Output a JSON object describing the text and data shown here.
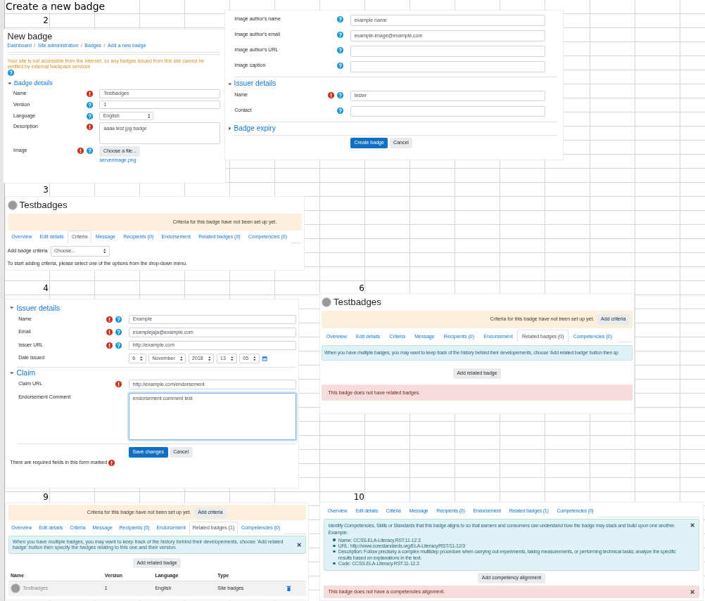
{
  "sheet": {
    "title": "Create a new badge",
    "step_numbers": [
      "2",
      "3",
      "4",
      "6",
      "9",
      "10"
    ]
  },
  "new_badge": {
    "heading": "New badge",
    "breadcrumb_separator": "/",
    "breadcrumbs": [
      "Dashboard",
      "Site administration",
      "Badges",
      "Add a new badge"
    ],
    "warning": "Your site is not accessible from the Internet, so any badges issued from this site cannot be verified by external backpack services",
    "section": {
      "title": "Badge details",
      "expanded": true
    },
    "fields": [
      {
        "label": "Name",
        "required": true,
        "help": false,
        "kind": "text",
        "value": "Testbadges"
      },
      {
        "label": "Version",
        "required": false,
        "help": true,
        "kind": "text",
        "value": "1"
      },
      {
        "label": "Language",
        "required": false,
        "help": true,
        "kind": "select",
        "value": "English"
      },
      {
        "label": "Description",
        "required": true,
        "help": false,
        "kind": "textarea",
        "value": "aaaa test jpg badge",
        "focused": false
      },
      {
        "label": "Image",
        "required": true,
        "help": true,
        "kind": "file",
        "value": "Choose a file...",
        "file_name": "serverimage.png"
      }
    ]
  },
  "new_badge_continued": {
    "fields": [
      {
        "label": "Image author's name",
        "required": false,
        "help": true,
        "kind": "text",
        "value": "example name"
      },
      {
        "label": "Image author's email",
        "required": false,
        "help": true,
        "kind": "text",
        "value": "example-image@example.com"
      },
      {
        "label": "Image author's URL",
        "required": false,
        "help": true,
        "kind": "text"
      },
      {
        "label": "Image caption",
        "required": false,
        "help": true,
        "kind": "text"
      }
    ],
    "sections": [
      {
        "title": "Issuer details",
        "expanded": true,
        "fields": [
          {
            "label": "Name",
            "required": true,
            "help": true,
            "kind": "text",
            "value": "tester"
          },
          {
            "label": "Contact",
            "required": false,
            "help": true,
            "kind": "text"
          }
        ]
      },
      {
        "title": "Badge expiry",
        "expanded": false
      }
    ],
    "buttons": [
      {
        "label": "Create badge",
        "primary": true
      },
      {
        "label": "Cancel",
        "primary": false
      }
    ]
  },
  "criteria_page": {
    "badge_name": "Testbadges",
    "notice": "Criteria for this badge have not been set up yet.",
    "tabs": [
      {
        "label": "Overview",
        "selected": false
      },
      {
        "label": "Edit details",
        "selected": false
      },
      {
        "label": "Criteria",
        "selected": true
      },
      {
        "label": "Message",
        "selected": false
      },
      {
        "label": "Recipients (0)",
        "selected": false
      },
      {
        "label": "Endorsement",
        "selected": false
      },
      {
        "label": "Related badges (0)",
        "selected": false
      },
      {
        "label": "Competencies (0)",
        "selected": false
      }
    ],
    "criteria_label": "Add badge criteria",
    "criteria_select": "Choose...",
    "hint": "To start adding criteria, please select one of the options from the drop-down menu."
  },
  "endorsement_form": {
    "sections": [
      {
        "title": "Issuer details",
        "expanded": true,
        "fields": [
          {
            "label": "Name",
            "required": true,
            "help": true,
            "kind": "text",
            "value": "Example"
          },
          {
            "label": "Email",
            "required": true,
            "help": true,
            "kind": "text",
            "value": "examplejaja@example.com"
          },
          {
            "label": "Issuer URL",
            "required": true,
            "help": true,
            "kind": "text",
            "value": "http://example.com"
          },
          {
            "label": "Date issued",
            "required": false,
            "help": false,
            "kind": "date",
            "parts": [
              "6",
              "November",
              "2018",
              "13",
              "05"
            ]
          }
        ]
      },
      {
        "title": "Claim",
        "expanded": true,
        "fields": [
          {
            "label": "Claim URL",
            "required": true,
            "help": false,
            "kind": "text",
            "value": "http://example.com/endorsement"
          },
          {
            "label": "Endorsement Comment",
            "required": false,
            "help": false,
            "kind": "textarea",
            "value": "endorsement comment test",
            "focused": true
          }
        ]
      }
    ],
    "buttons": [
      {
        "label": "Save changes",
        "primary": true
      },
      {
        "label": "Cancel",
        "primary": false
      }
    ],
    "footnote": "There are required fields in this form marked"
  },
  "related_badges_empty": {
    "badge_name": "Testbadges",
    "notice": "Criteria for this badge have not been set up yet.",
    "notice_button": "Add criteria",
    "tabs": [
      {
        "label": "Overview",
        "selected": false
      },
      {
        "label": "Edit details",
        "selected": false
      },
      {
        "label": "Criteria",
        "selected": false
      },
      {
        "label": "Message",
        "selected": false
      },
      {
        "label": "Recipients (0)",
        "selected": false
      },
      {
        "label": "Endorsement",
        "selected": false
      },
      {
        "label": "Related badges (0)",
        "selected": true
      },
      {
        "label": "Competencies (0)",
        "selected": false
      }
    ],
    "info": "When you have multiple badges, you may want to keep track of the history behind their developements, choose 'Add related badge' button then sp",
    "add_button": "Add related badge",
    "empty_message": "This badge does not have related badges."
  },
  "related_badges_list": {
    "notice": "Criteria for this badge have not been set up yet.",
    "notice_button": "Add criteria",
    "tabs": [
      {
        "label": "Overview",
        "selected": false
      },
      {
        "label": "Edit details",
        "selected": false
      },
      {
        "label": "Criteria",
        "selected": false
      },
      {
        "label": "Message",
        "selected": false
      },
      {
        "label": "Recipients (0)",
        "selected": false
      },
      {
        "label": "Endorsement",
        "selected": false
      },
      {
        "label": "Related badges (1)",
        "selected": true
      },
      {
        "label": "Competencies (0)",
        "selected": false
      }
    ],
    "info": "When you have multiple badges, you may want to keep track of the history behind their developements, choose 'Add related badge' button then specify the badges relating to this one and their version.",
    "info_dismissible": true,
    "add_button": "Add related badge",
    "table": {
      "columns": [
        "Name",
        "Version",
        "Language",
        "Type"
      ],
      "rows": [
        {
          "name": "Testbadges",
          "version": "1",
          "language": "English",
          "type": "Site badges"
        }
      ]
    }
  },
  "competencies": {
    "tabs": [
      {
        "label": "Overview",
        "selected": false
      },
      {
        "label": "Edit details",
        "selected": false
      },
      {
        "label": "Criteria",
        "selected": false
      },
      {
        "label": "Message",
        "selected": false
      },
      {
        "label": "Recipients (0)",
        "selected": false
      },
      {
        "label": "Endorsement",
        "selected": false
      },
      {
        "label": "Related badges (1)",
        "selected": false
      },
      {
        "label": "Competencies (0)",
        "selected": false
      }
    ],
    "info": {
      "intro": "Identify Competencies, Skills or Standards that this badge aligns to so that earners and consumers can understand how the badge may stack and build upon one another.",
      "example_label": "Example:",
      "dismissible": true,
      "items": [
        "Name: CCSS.ELA-Literacy.RST.11-12.3",
        "URL: http://www.corestandards.org/ELA-Literacy/RST/11-12/3",
        "Description: Follow precisely a complex multistep procedure when carrying out experiments, taking measurements, or performing technical tasks; analyze the specific results based on explanations in the text.",
        "Code: CCSS.ELA-Literacy.RST.11-12.3"
      ]
    },
    "add_button": "Add competency alignment",
    "empty_message": "This badge does not have a competencies alignment.",
    "empty_dismissible": true
  }
}
